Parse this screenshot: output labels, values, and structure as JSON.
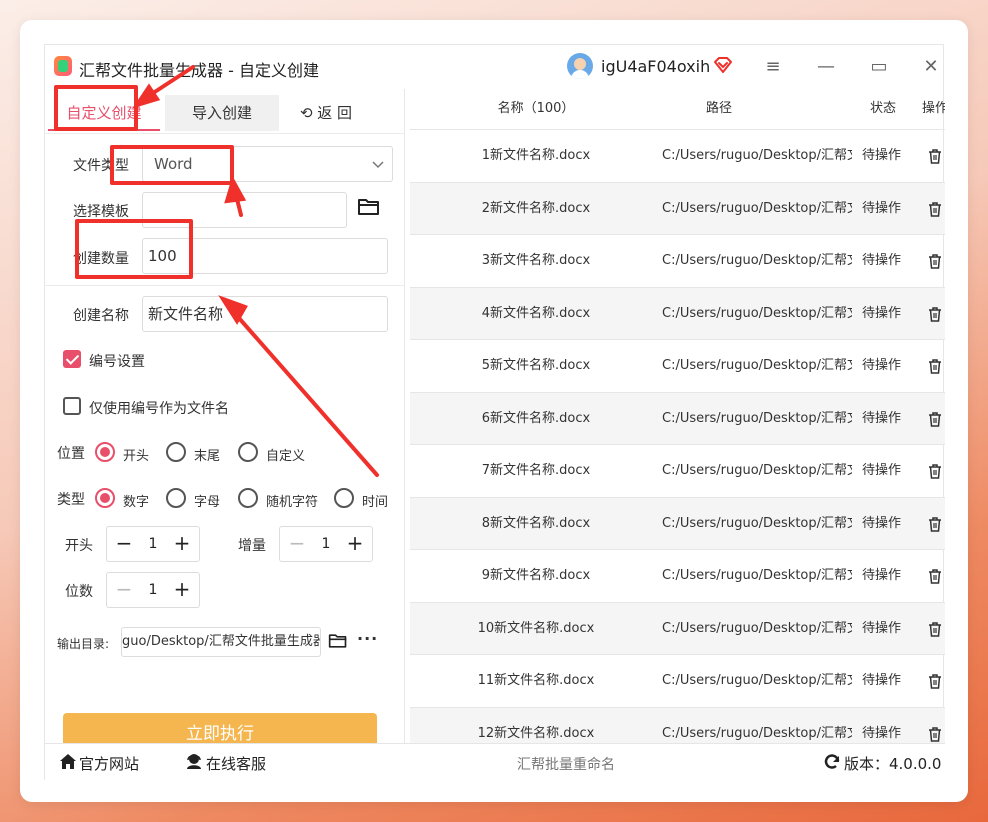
{
  "window": {
    "title": "汇帮文件批量生成器 - 自定义创建",
    "username": "igU4aF04oxih",
    "controls": [
      "≡",
      "—",
      "▭",
      "✕"
    ]
  },
  "tabs": {
    "custom": "自定义创建",
    "import": "导入创建",
    "back": "⟲ 返 回"
  },
  "form": {
    "file_type_label": "文件类型",
    "file_type_value": "Word",
    "template_label": "选择模板",
    "template_value": "",
    "count_label": "创建数量",
    "count_value": "100",
    "name_label": "创建名称",
    "name_value": "新文件名称",
    "numbering_label": "编号设置",
    "numbering_checked": true,
    "only_number_label": "仅使用编号作为文件名",
    "only_number_checked": false,
    "position_label": "位置",
    "position_options": [
      "开头",
      "末尾",
      "自定义"
    ],
    "position_selected": "开头",
    "type_label": "类型",
    "type_options": [
      "数字",
      "字母",
      "随机字符",
      "时间"
    ],
    "type_selected": "数字",
    "start_label": "开头",
    "start_value": "1",
    "increment_label": "增量",
    "increment_value": "1",
    "digits_label": "位数",
    "digits_value": "1",
    "output_label": "输出目录:",
    "output_value": "guo/Desktop/汇帮文件批量生成器",
    "execute_label": "立即执行"
  },
  "table": {
    "headers": [
      "名称（100）",
      "路径",
      "状态",
      "操作"
    ],
    "rows": [
      {
        "name": "1新文件名称.docx",
        "path": "C:/Users/ruguo/Desktop/汇帮文",
        "status": "待操作"
      },
      {
        "name": "2新文件名称.docx",
        "path": "C:/Users/ruguo/Desktop/汇帮文",
        "status": "待操作"
      },
      {
        "name": "3新文件名称.docx",
        "path": "C:/Users/ruguo/Desktop/汇帮文",
        "status": "待操作"
      },
      {
        "name": "4新文件名称.docx",
        "path": "C:/Users/ruguo/Desktop/汇帮文",
        "status": "待操作"
      },
      {
        "name": "5新文件名称.docx",
        "path": "C:/Users/ruguo/Desktop/汇帮文",
        "status": "待操作"
      },
      {
        "name": "6新文件名称.docx",
        "path": "C:/Users/ruguo/Desktop/汇帮文",
        "status": "待操作"
      },
      {
        "name": "7新文件名称.docx",
        "path": "C:/Users/ruguo/Desktop/汇帮文",
        "status": "待操作"
      },
      {
        "name": "8新文件名称.docx",
        "path": "C:/Users/ruguo/Desktop/汇帮文",
        "status": "待操作"
      },
      {
        "name": "9新文件名称.docx",
        "path": "C:/Users/ruguo/Desktop/汇帮文",
        "status": "待操作"
      },
      {
        "name": "10新文件名称.docx",
        "path": "C:/Users/ruguo/Desktop/汇帮文",
        "status": "待操作"
      },
      {
        "name": "11新文件名称.docx",
        "path": "C:/Users/ruguo/Desktop/汇帮文",
        "status": "待操作"
      },
      {
        "name": "12新文件名称.docx",
        "path": "C:/Users/ruguo/Desktop/汇帮文",
        "status": "待操作"
      }
    ]
  },
  "footer": {
    "website": "官方网站",
    "support": "在线客服",
    "center": "汇帮批量重命名",
    "version": "版本：4.0.0.0"
  },
  "colors": {
    "accent": "#e84f6a",
    "execute_button": "#f5b54f",
    "annotation": "#f0302a"
  },
  "icons": [
    "app-icon",
    "avatar",
    "vip-diamond-icon",
    "menu-icon",
    "minimize-icon",
    "maximize-icon",
    "close-icon",
    "chevron-down-icon",
    "folder-icon",
    "more-icon",
    "trash-icon",
    "home-icon",
    "support-icon",
    "refresh-icon"
  ]
}
